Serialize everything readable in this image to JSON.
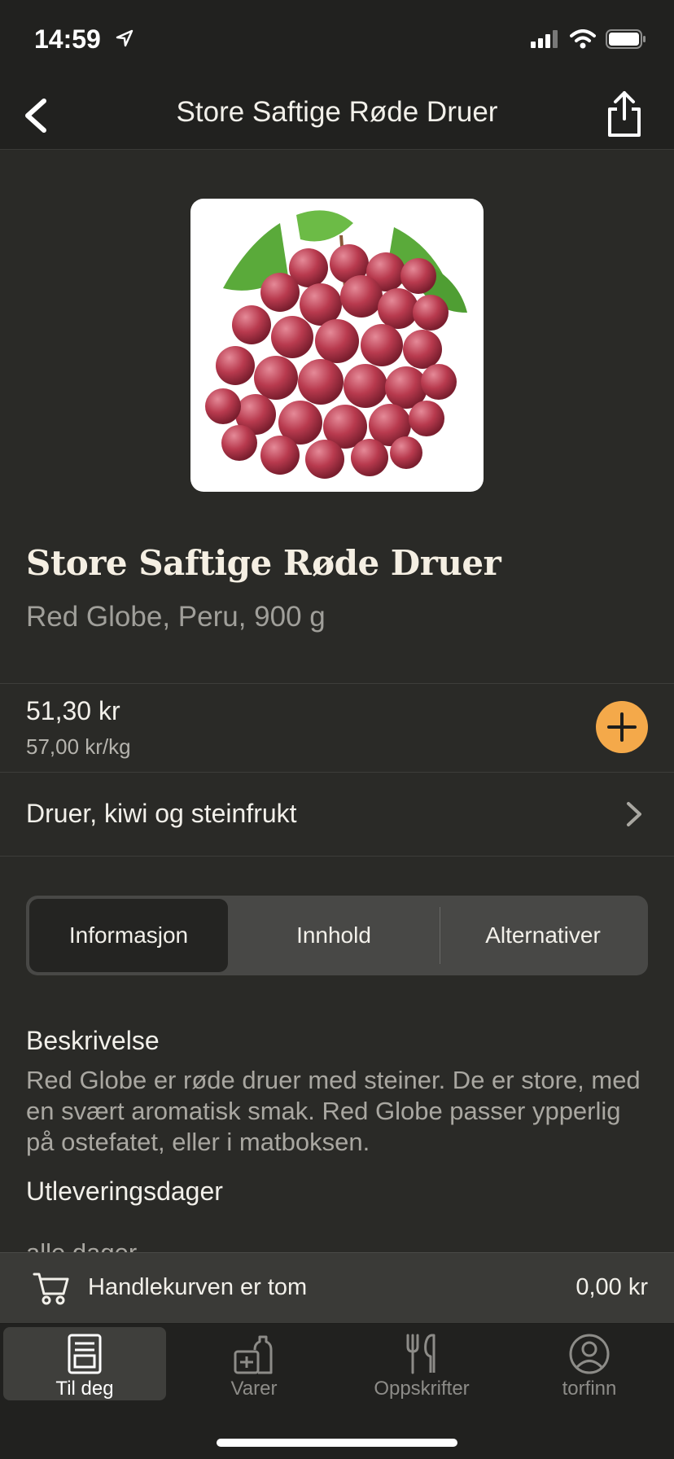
{
  "status_bar": {
    "time": "14:59"
  },
  "nav": {
    "title": "Store Saftige Røde Druer"
  },
  "product": {
    "title": "Store Saftige Røde Druer",
    "subtitle": "Red Globe, Peru, 900 g",
    "price": "51,30 kr",
    "unit_price": "57,00 kr/kg",
    "category": "Druer, kiwi og steinfrukt"
  },
  "tabs_segmented": [
    {
      "label": "Informasjon",
      "active": true
    },
    {
      "label": "Innhold",
      "active": false
    },
    {
      "label": "Alternativer",
      "active": false
    }
  ],
  "info": {
    "description_heading": "Beskrivelse",
    "description_text": "Red Globe er røde druer med steiner. De er store, med en svært aromatisk smak. Red Globe passer ypperlig på ostefatet, eller i matboksen.",
    "delivery_heading": "Utleveringsdager",
    "delivery_text": "alle dager"
  },
  "cart": {
    "label": "Handlekurven er tom",
    "total": "0,00 kr"
  },
  "bottom_tabs": [
    {
      "label": "Til deg",
      "icon": "doc-icon",
      "active": true
    },
    {
      "label": "Varer",
      "icon": "groceries-icon",
      "active": false
    },
    {
      "label": "Oppskrifter",
      "icon": "utensils-icon",
      "active": false
    },
    {
      "label": "torfinn",
      "icon": "profile-icon",
      "active": false
    }
  ],
  "colors": {
    "background": "#2a2a27",
    "accent": "#f4a94a",
    "text": "#f2f0ea",
    "muted": "#a09f9a"
  }
}
